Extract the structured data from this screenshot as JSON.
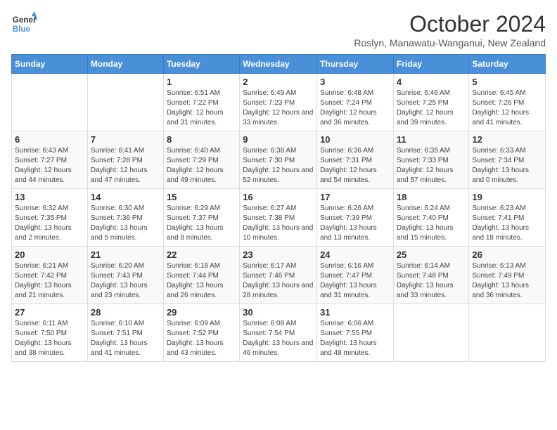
{
  "logo": {
    "line1": "General",
    "line2": "Blue"
  },
  "title": "October 2024",
  "subtitle": "Roslyn, Manawatu-Wanganui, New Zealand",
  "days_of_week": [
    "Sunday",
    "Monday",
    "Tuesday",
    "Wednesday",
    "Thursday",
    "Friday",
    "Saturday"
  ],
  "weeks": [
    [
      {
        "day": "",
        "info": ""
      },
      {
        "day": "",
        "info": ""
      },
      {
        "day": "1",
        "info": "Sunrise: 6:51 AM\nSunset: 7:22 PM\nDaylight: 12 hours and 31 minutes."
      },
      {
        "day": "2",
        "info": "Sunrise: 6:49 AM\nSunset: 7:23 PM\nDaylight: 12 hours and 33 minutes."
      },
      {
        "day": "3",
        "info": "Sunrise: 6:48 AM\nSunset: 7:24 PM\nDaylight: 12 hours and 36 minutes."
      },
      {
        "day": "4",
        "info": "Sunrise: 6:46 AM\nSunset: 7:25 PM\nDaylight: 12 hours and 39 minutes."
      },
      {
        "day": "5",
        "info": "Sunrise: 6:45 AM\nSunset: 7:26 PM\nDaylight: 12 hours and 41 minutes."
      }
    ],
    [
      {
        "day": "6",
        "info": "Sunrise: 6:43 AM\nSunset: 7:27 PM\nDaylight: 12 hours and 44 minutes."
      },
      {
        "day": "7",
        "info": "Sunrise: 6:41 AM\nSunset: 7:28 PM\nDaylight: 12 hours and 47 minutes."
      },
      {
        "day": "8",
        "info": "Sunrise: 6:40 AM\nSunset: 7:29 PM\nDaylight: 12 hours and 49 minutes."
      },
      {
        "day": "9",
        "info": "Sunrise: 6:38 AM\nSunset: 7:30 PM\nDaylight: 12 hours and 52 minutes."
      },
      {
        "day": "10",
        "info": "Sunrise: 6:36 AM\nSunset: 7:31 PM\nDaylight: 12 hours and 54 minutes."
      },
      {
        "day": "11",
        "info": "Sunrise: 6:35 AM\nSunset: 7:33 PM\nDaylight: 12 hours and 57 minutes."
      },
      {
        "day": "12",
        "info": "Sunrise: 6:33 AM\nSunset: 7:34 PM\nDaylight: 13 hours and 0 minutes."
      }
    ],
    [
      {
        "day": "13",
        "info": "Sunrise: 6:32 AM\nSunset: 7:35 PM\nDaylight: 13 hours and 2 minutes."
      },
      {
        "day": "14",
        "info": "Sunrise: 6:30 AM\nSunset: 7:36 PM\nDaylight: 13 hours and 5 minutes."
      },
      {
        "day": "15",
        "info": "Sunrise: 6:29 AM\nSunset: 7:37 PM\nDaylight: 13 hours and 8 minutes."
      },
      {
        "day": "16",
        "info": "Sunrise: 6:27 AM\nSunset: 7:38 PM\nDaylight: 13 hours and 10 minutes."
      },
      {
        "day": "17",
        "info": "Sunrise: 6:26 AM\nSunset: 7:39 PM\nDaylight: 13 hours and 13 minutes."
      },
      {
        "day": "18",
        "info": "Sunrise: 6:24 AM\nSunset: 7:40 PM\nDaylight: 13 hours and 15 minutes."
      },
      {
        "day": "19",
        "info": "Sunrise: 6:23 AM\nSunset: 7:41 PM\nDaylight: 13 hours and 18 minutes."
      }
    ],
    [
      {
        "day": "20",
        "info": "Sunrise: 6:21 AM\nSunset: 7:42 PM\nDaylight: 13 hours and 21 minutes."
      },
      {
        "day": "21",
        "info": "Sunrise: 6:20 AM\nSunset: 7:43 PM\nDaylight: 13 hours and 23 minutes."
      },
      {
        "day": "22",
        "info": "Sunrise: 6:18 AM\nSunset: 7:44 PM\nDaylight: 13 hours and 26 minutes."
      },
      {
        "day": "23",
        "info": "Sunrise: 6:17 AM\nSunset: 7:46 PM\nDaylight: 13 hours and 28 minutes."
      },
      {
        "day": "24",
        "info": "Sunrise: 6:16 AM\nSunset: 7:47 PM\nDaylight: 13 hours and 31 minutes."
      },
      {
        "day": "25",
        "info": "Sunrise: 6:14 AM\nSunset: 7:48 PM\nDaylight: 13 hours and 33 minutes."
      },
      {
        "day": "26",
        "info": "Sunrise: 6:13 AM\nSunset: 7:49 PM\nDaylight: 13 hours and 36 minutes."
      }
    ],
    [
      {
        "day": "27",
        "info": "Sunrise: 6:11 AM\nSunset: 7:50 PM\nDaylight: 13 hours and 38 minutes."
      },
      {
        "day": "28",
        "info": "Sunrise: 6:10 AM\nSunset: 7:51 PM\nDaylight: 13 hours and 41 minutes."
      },
      {
        "day": "29",
        "info": "Sunrise: 6:09 AM\nSunset: 7:52 PM\nDaylight: 13 hours and 43 minutes."
      },
      {
        "day": "30",
        "info": "Sunrise: 6:08 AM\nSunset: 7:54 PM\nDaylight: 13 hours and 46 minutes."
      },
      {
        "day": "31",
        "info": "Sunrise: 6:06 AM\nSunset: 7:55 PM\nDaylight: 13 hours and 48 minutes."
      },
      {
        "day": "",
        "info": ""
      },
      {
        "day": "",
        "info": ""
      }
    ]
  ]
}
